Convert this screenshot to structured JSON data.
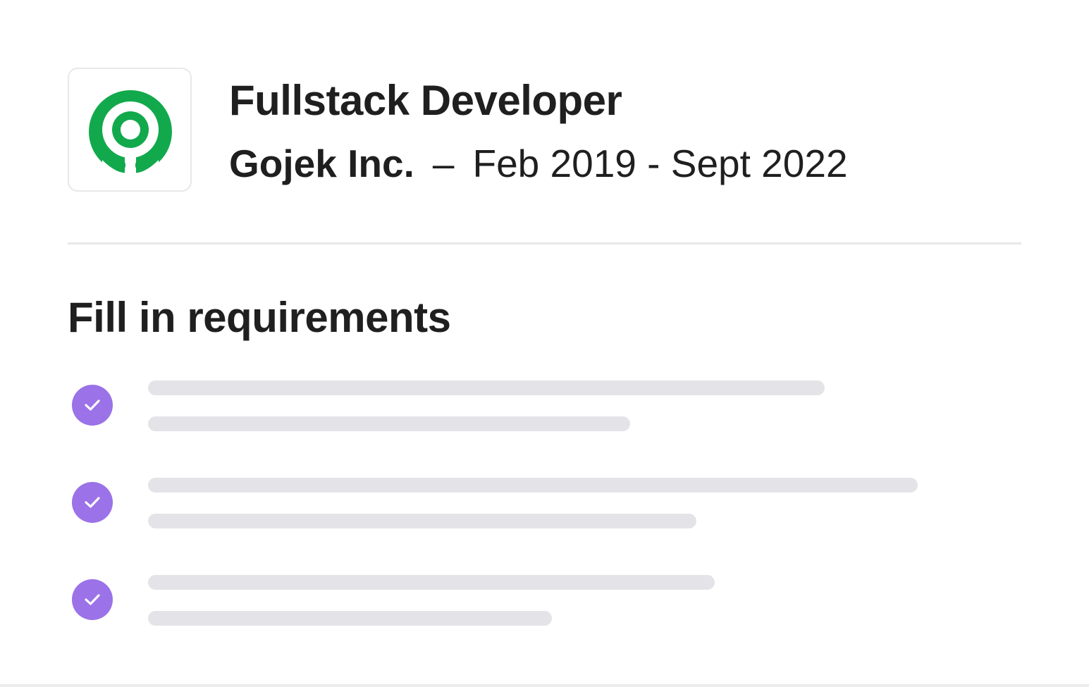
{
  "job": {
    "title": "Fullstack Developer",
    "company": "Gojek Inc.",
    "separator": "–",
    "dates": "Feb 2019 - Sept 2022",
    "logo_icon": "gojek-logo-icon",
    "logo_color": "#12a94d"
  },
  "requirements": {
    "title": "Fill in requirements",
    "check_color": "#9b72e8",
    "placeholder_color": "#e4e4e8",
    "items": [
      {
        "icon": "check-circle-icon",
        "completed": true
      },
      {
        "icon": "check-circle-icon",
        "completed": true
      },
      {
        "icon": "check-circle-icon",
        "completed": true
      }
    ]
  }
}
